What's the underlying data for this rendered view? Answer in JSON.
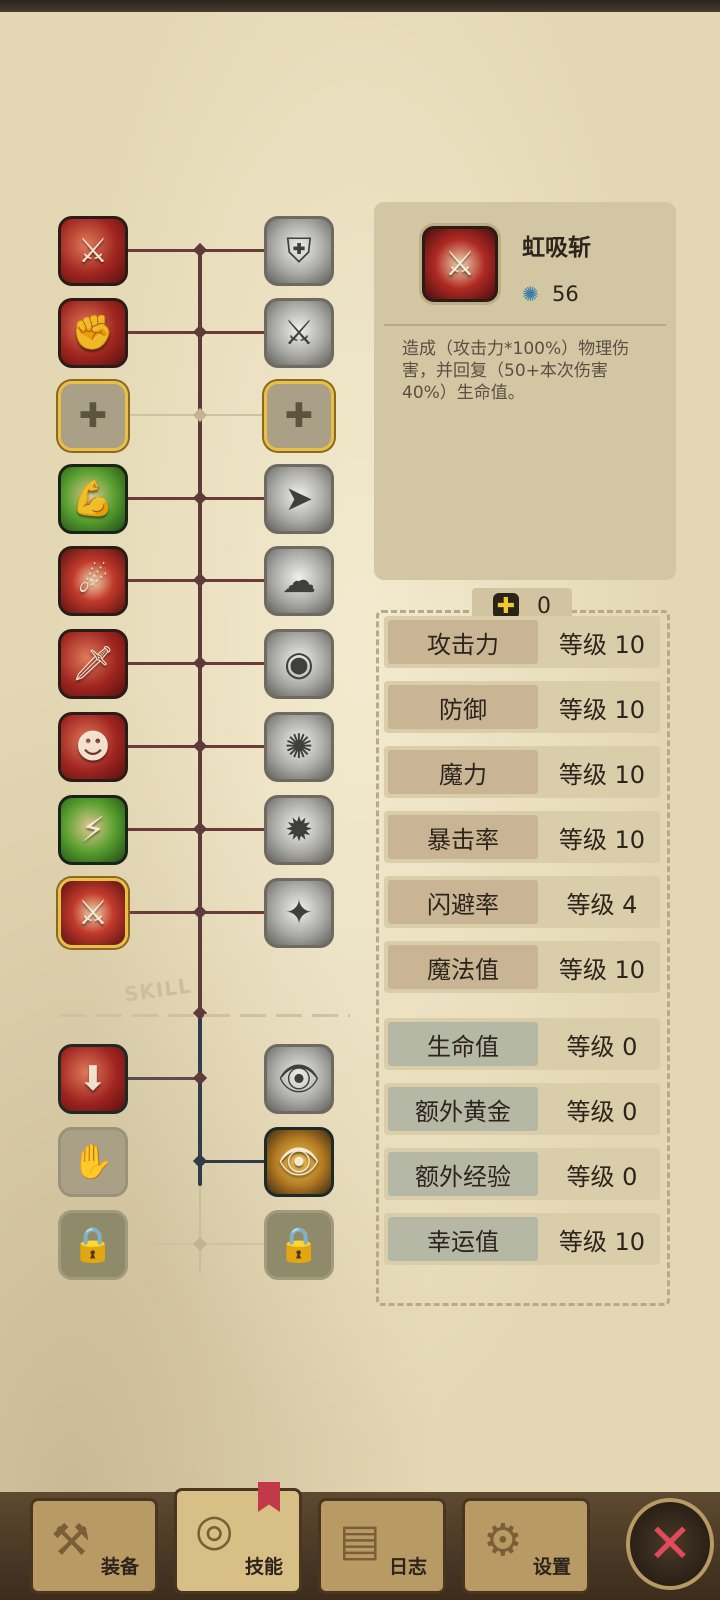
{
  "skills_left": [
    {
      "icon": "claw-slash-icon",
      "glyph": "⚔",
      "style": "red"
    },
    {
      "icon": "flame-punch-icon",
      "glyph": "✊",
      "style": "red"
    },
    {
      "icon": "heal-upgrade-icon",
      "glyph": "✚",
      "style": "dim"
    },
    {
      "icon": "muscle-arm-icon",
      "glyph": "💪",
      "style": "green"
    },
    {
      "icon": "dash-strike-icon",
      "glyph": "☄",
      "style": "red2"
    },
    {
      "icon": "dagger-icon",
      "glyph": "🗡",
      "style": "red"
    },
    {
      "icon": "shadow-ninja-icon",
      "glyph": "☻",
      "style": "red"
    },
    {
      "icon": "lightning-body-icon",
      "glyph": "⚡",
      "style": "green"
    },
    {
      "icon": "vampire-slash-icon",
      "glyph": "⚔",
      "style": "red2"
    },
    {
      "icon": "treasure-pull-icon",
      "glyph": "⬇",
      "style": "red"
    },
    {
      "icon": "glove-chest-icon",
      "glyph": "✋",
      "style": "dim"
    },
    {
      "icon": "lock-icon",
      "glyph": "🔒",
      "style": "locked"
    }
  ],
  "skills_right": [
    {
      "icon": "shield-cross-icon",
      "glyph": "⛨",
      "style": "gray"
    },
    {
      "icon": "sword-swing-icon",
      "glyph": "⚔",
      "style": "gray"
    },
    {
      "icon": "heal-lightning-icon",
      "glyph": "✚",
      "style": "dim"
    },
    {
      "icon": "charge-icon",
      "glyph": "➤",
      "style": "gray"
    },
    {
      "icon": "smoke-clone-icon",
      "glyph": "☁",
      "style": "gray"
    },
    {
      "icon": "eye-burst-icon",
      "glyph": "◉",
      "style": "gray"
    },
    {
      "icon": "whirl-slash-icon",
      "glyph": "✺",
      "style": "gray"
    },
    {
      "icon": "sun-burst-icon",
      "glyph": "✹",
      "style": "gray"
    },
    {
      "icon": "sparkle-heal-icon",
      "glyph": "✦",
      "style": "gray"
    },
    {
      "icon": "eye-chest-icon",
      "glyph": "👁",
      "style": "gray"
    },
    {
      "icon": "golden-eye-chest-icon",
      "glyph": "👁",
      "style": "red2"
    },
    {
      "icon": "lock-icon",
      "glyph": "🔒",
      "style": "locked"
    }
  ],
  "tree_label": "SKILL",
  "detail": {
    "name": "虹吸斩",
    "icon": "vampire-slash-icon",
    "glyph": "⚔",
    "cost_icon": "gear-gem-icon",
    "cost_glyph": "✺",
    "cost": "56",
    "description": "造成（攻击力*100%）物理伤害，并回复（50+本次伤害40%）生命值。"
  },
  "points": {
    "icon": "plus-icon",
    "glyph": "✚",
    "value": "0"
  },
  "stats_combat": [
    {
      "name": "攻击力",
      "level": "等级 10"
    },
    {
      "name": "防御",
      "level": "等级 10"
    },
    {
      "name": "魔力",
      "level": "等级 10"
    },
    {
      "name": "暴击率",
      "level": "等级 10"
    },
    {
      "name": "闪避率",
      "level": "等级 4"
    },
    {
      "name": "魔法值",
      "level": "等级 10"
    }
  ],
  "stats_misc": [
    {
      "name": "生命值",
      "level": "等级 0"
    },
    {
      "name": "额外黄金",
      "level": "等级 0"
    },
    {
      "name": "额外经验",
      "level": "等级 0"
    },
    {
      "name": "幸运值",
      "level": "等级 10"
    }
  ],
  "nav": [
    {
      "label": "装备",
      "icon": "axe-icon",
      "glyph": "⚒",
      "active": false
    },
    {
      "label": "技能",
      "icon": "skill-ring-icon",
      "glyph": "◎",
      "active": true
    },
    {
      "label": "日志",
      "icon": "scroll-icon",
      "glyph": "▤",
      "active": false
    },
    {
      "label": "设置",
      "icon": "gear-icon",
      "glyph": "⚙",
      "active": false
    }
  ],
  "close": {
    "icon": "close-icon",
    "glyph": "✕"
  },
  "colors": {
    "accent_selected": "#e8c048",
    "close_x": "#e04a5a",
    "tree_line": "#5e3a3a",
    "tree_line_dark": "#2f3c4a"
  }
}
